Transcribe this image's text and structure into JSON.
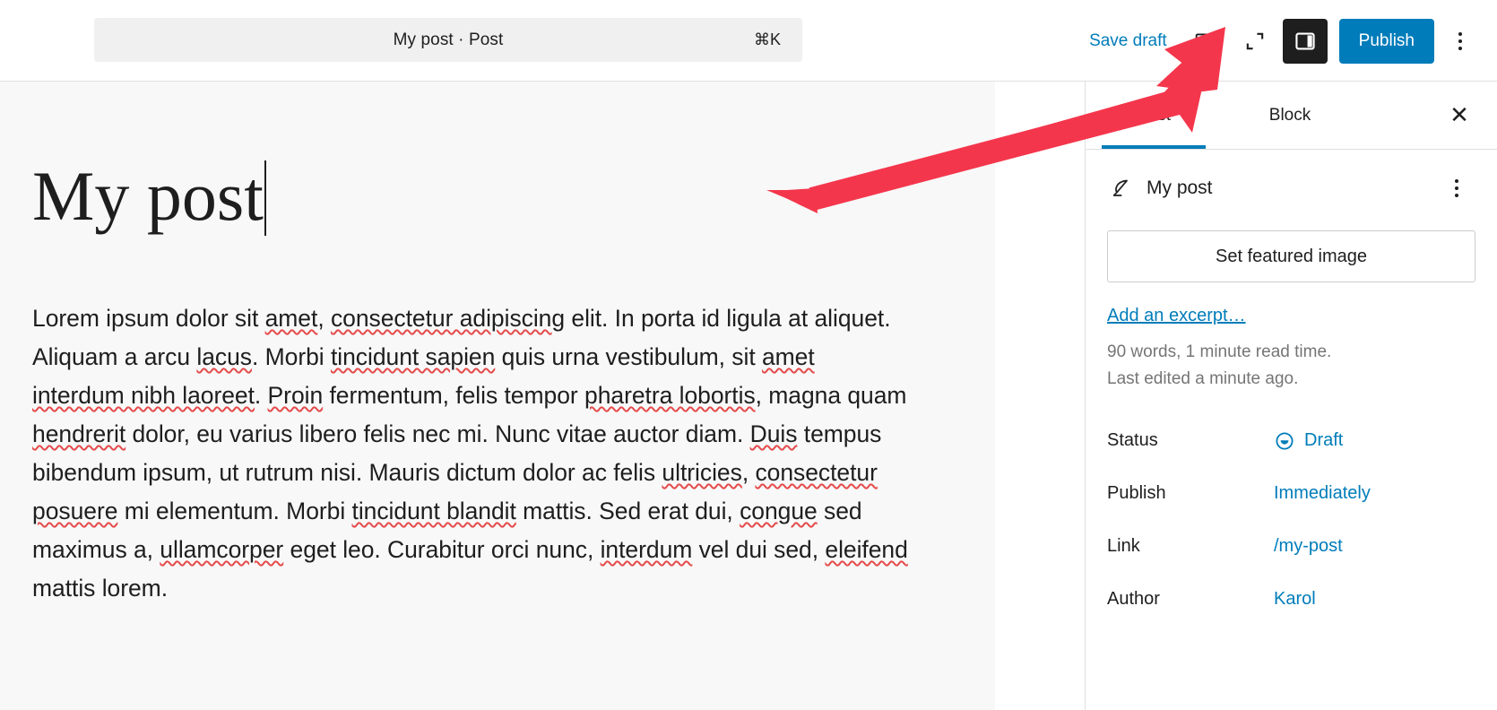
{
  "header": {
    "command_bar": {
      "label": "My post · Post",
      "shortcut": "⌘K"
    },
    "save_draft_label": "Save draft",
    "preview_icon": "desktop-preview-icon",
    "zoom_out_icon": "zoom-out-icon",
    "sidebar_toggle_icon": "settings-sidebar-icon",
    "publish_label": "Publish",
    "more_menu_icon": "more-options-icon"
  },
  "editor": {
    "title": "My post",
    "paragraph": {
      "segments": [
        {
          "text": "Lorem ipsum dolor sit ",
          "spell": false
        },
        {
          "text": "amet",
          "spell": true
        },
        {
          "text": ", ",
          "spell": false
        },
        {
          "text": "consectetur adipiscing",
          "spell": true
        },
        {
          "text": " elit. In porta id ligula at aliquet. Aliquam a arcu ",
          "spell": false
        },
        {
          "text": "lacus",
          "spell": true
        },
        {
          "text": ". Morbi ",
          "spell": false
        },
        {
          "text": "tincidunt sapien",
          "spell": true
        },
        {
          "text": " quis urna vestibulum, sit ",
          "spell": false
        },
        {
          "text": "amet interdum nibh laoreet",
          "spell": true
        },
        {
          "text": ". ",
          "spell": false
        },
        {
          "text": "Proin",
          "spell": true
        },
        {
          "text": " fermentum, felis tempor ",
          "spell": false
        },
        {
          "text": "pharetra lobortis",
          "spell": true
        },
        {
          "text": ", magna quam ",
          "spell": false
        },
        {
          "text": "hendrerit",
          "spell": true
        },
        {
          "text": " dolor, eu varius libero felis nec mi. Nunc vitae auctor diam. ",
          "spell": false
        },
        {
          "text": "Duis",
          "spell": true
        },
        {
          "text": " tempus bibendum ipsum, ut rutrum nisi. Mauris dictum dolor ac felis ",
          "spell": false
        },
        {
          "text": "ultricies",
          "spell": true
        },
        {
          "text": ", ",
          "spell": false
        },
        {
          "text": "consectetur posuere",
          "spell": true
        },
        {
          "text": " mi elementum. Morbi ",
          "spell": false
        },
        {
          "text": "tincidunt blandit",
          "spell": true
        },
        {
          "text": " mattis. Sed erat dui, ",
          "spell": false
        },
        {
          "text": "congue",
          "spell": true
        },
        {
          "text": " sed maximus a, ",
          "spell": false
        },
        {
          "text": "ullamcorper",
          "spell": true
        },
        {
          "text": " eget leo. Curabitur orci nunc, ",
          "spell": false
        },
        {
          "text": "interdum",
          "spell": true
        },
        {
          "text": " vel dui sed, ",
          "spell": false
        },
        {
          "text": "eleifend",
          "spell": true
        },
        {
          "text": " mattis lorem.",
          "spell": false
        }
      ]
    }
  },
  "sidebar": {
    "tabs": [
      {
        "label": "Post",
        "active": true
      },
      {
        "label": "Block",
        "active": false
      }
    ],
    "close_label": "✕",
    "post_name": "My post",
    "post_icon": "quill-icon",
    "post_actions_icon": "more-options-icon",
    "featured_image_label": "Set featured image",
    "excerpt_link_label": "Add an excerpt…",
    "word_count_note": "90 words, 1 minute read time.",
    "last_edited_note": "Last edited a minute ago.",
    "fields": [
      {
        "key": "Status",
        "value": "Draft",
        "icon": "draft-status-icon"
      },
      {
        "key": "Publish",
        "value": "Immediately",
        "icon": ""
      },
      {
        "key": "Link",
        "value": "/my-post",
        "icon": ""
      },
      {
        "key": "Author",
        "value": "Karol",
        "icon": ""
      }
    ]
  },
  "annotation": {
    "arrow_color": "#f4364c",
    "arrow_target": "settings-sidebar-icon"
  },
  "colors": {
    "accent": "#007cba",
    "text": "#1e1e1e",
    "muted": "#757575",
    "canvas": "#f8f8f8",
    "toolbar_active_bg": "#1e1e1e"
  }
}
